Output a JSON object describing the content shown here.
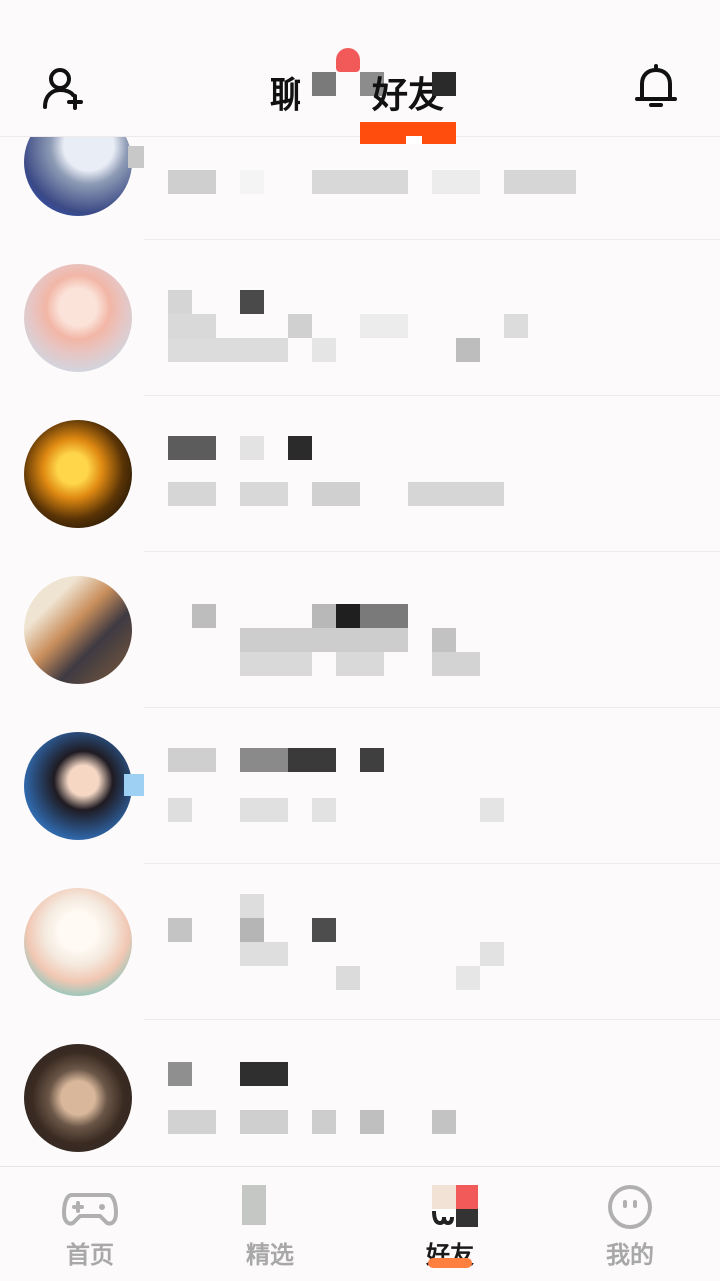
{
  "header": {
    "tabs": [
      {
        "label": "聊天"
      },
      {
        "label": "好友"
      }
    ],
    "active_tab": "好友",
    "icons": {
      "left": "add-friend-icon",
      "right": "bell-icon"
    },
    "accent": "#ff4d0d",
    "badge_color": "#f25a5a"
  },
  "friends": [
    {
      "avatar": "avatar-anime-silver-hair"
    },
    {
      "avatar": "avatar-anime-pink-hair"
    },
    {
      "avatar": "avatar-anime-naruto"
    },
    {
      "avatar": "avatar-anime-cafe-girl"
    },
    {
      "avatar": "avatar-anime-black-hair-girl"
    },
    {
      "avatar": "avatar-anime-white-hair"
    },
    {
      "avatar": "avatar-anime-brown-hair-boy"
    }
  ],
  "nav": {
    "items": [
      {
        "label": "首页",
        "icon": "gamepad-icon"
      },
      {
        "label": "精选",
        "icon": "featured-icon"
      },
      {
        "label": "好友",
        "icon": "friends-icon"
      },
      {
        "label": "我的",
        "icon": "smiley-icon"
      }
    ],
    "active": "好友"
  }
}
